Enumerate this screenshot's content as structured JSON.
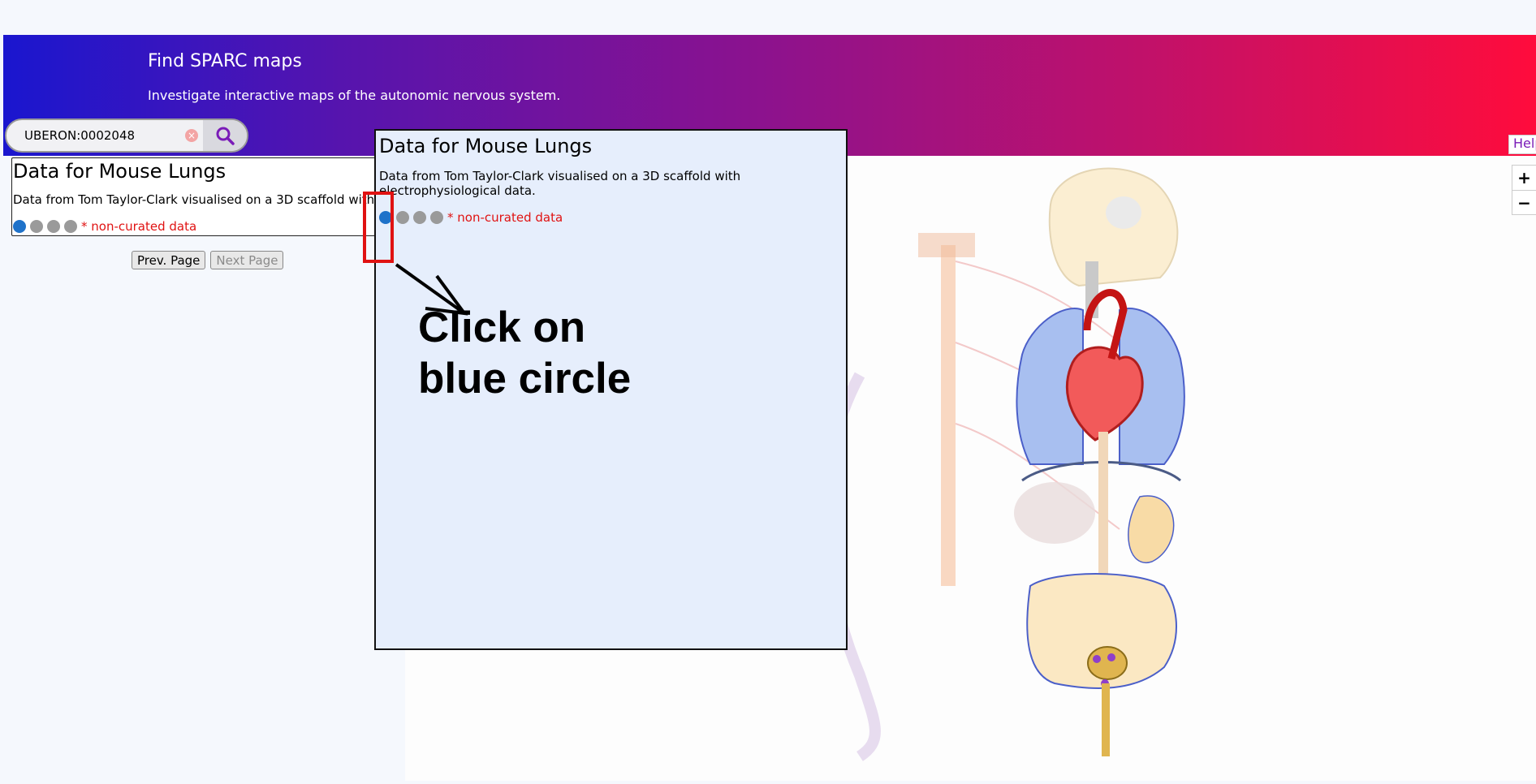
{
  "header": {
    "title": "Find SPARC maps",
    "subtitle": "Investigate interactive maps of the autonomic nervous system."
  },
  "search": {
    "value": "UBERON:0002048",
    "clear_icon": "×"
  },
  "help_label": "Help",
  "zoom": {
    "in": "+",
    "out": "−"
  },
  "result": {
    "title": "Data for Mouse Lungs",
    "description": "Data from Tom Taylor-Clark visualised on a 3D scaffold with electrophysiological data.",
    "dots": [
      "blue",
      "grey",
      "grey",
      "grey"
    ],
    "non_curated": "* non-curated data"
  },
  "pager": {
    "prev": "Prev. Page",
    "next": "Next Page"
  },
  "annotation": {
    "line1": "Click on",
    "line2": "blue circle"
  },
  "colors": {
    "accent_blue": "#1f72c9",
    "non_curated_red": "#e01212",
    "gradient_start": "#1a16cf",
    "gradient_end": "#ff0c3c"
  }
}
